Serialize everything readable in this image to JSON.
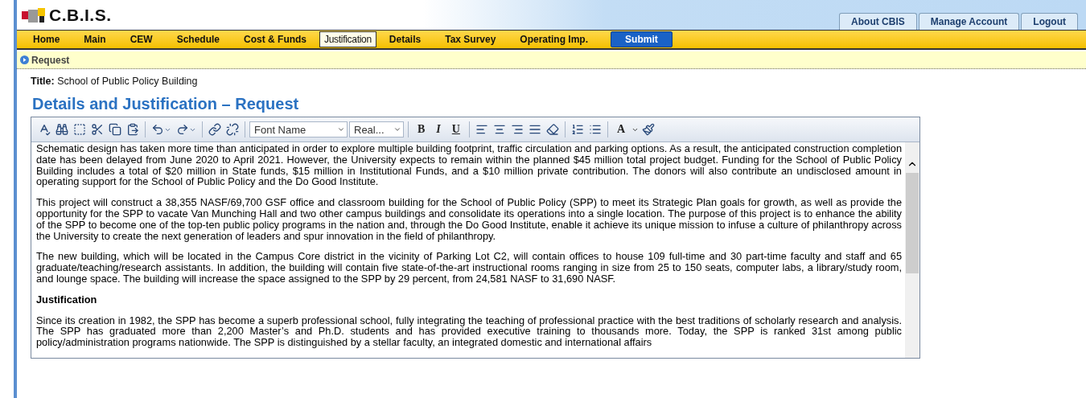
{
  "app": {
    "title": "C.B.I.S."
  },
  "top_links": [
    {
      "label": "About CBIS"
    },
    {
      "label": "Manage Account"
    },
    {
      "label": "Logout"
    }
  ],
  "menu": [
    {
      "label": "Home",
      "kind": "tab",
      "selected": false
    },
    {
      "label": "Main",
      "kind": "tab",
      "selected": false
    },
    {
      "label": "CEW",
      "kind": "tab",
      "selected": false
    },
    {
      "label": "Schedule",
      "kind": "tab",
      "selected": false
    },
    {
      "label": "Cost & Funds",
      "kind": "tab",
      "selected": false
    },
    {
      "label": "Justification",
      "kind": "tab",
      "selected": true
    },
    {
      "label": "Details",
      "kind": "tab",
      "selected": false
    },
    {
      "label": "Tax Survey",
      "kind": "tab",
      "selected": false
    },
    {
      "label": "Operating Imp.",
      "kind": "tab",
      "selected": false
    },
    {
      "label": "Submit",
      "kind": "button"
    }
  ],
  "breadcrumb": "Request",
  "title_label": "Title:",
  "title_value": "School of Public Policy Building",
  "heading": "Details and Justification – Request",
  "editor": {
    "font_name": "Font Name",
    "font_size": "Real...",
    "bold": "B",
    "italic": "I",
    "underline": "U",
    "font_color": "A",
    "content": [
      {
        "kind": "paragraph",
        "text": "Schematic design has taken more time than anticipated in order to explore multiple building footprint, traffic circulation and parking options. As a result, the anticipated construction completion date has been delayed from June 2020 to April 2021. However, the University expects to remain within the planned $45 million total project budget. Funding for the School of Public Policy Building includes a total of $20 million in State funds, $15 million in Institutional Funds, and a $10 million private contribution. The donors will also contribute an undisclosed amount in operating support for the School of Public Policy and the Do Good Institute."
      },
      {
        "kind": "paragraph",
        "text": "This project will construct a 38,355 NASF/69,700 GSF office and classroom building for the School of Public Policy (SPP) to meet its Strategic Plan goals for growth, as well as provide the opportunity for the SPP to vacate Van Munching Hall and two other campus buildings and consolidate its operations into a single location. The purpose of this project is to enhance the ability of the SPP to become one of the top-ten public policy programs in the nation and, through the Do Good Institute, enable it achieve its unique mission to infuse a culture of philanthropy across the University to create the next generation of leaders and spur innovation in the field of philanthropy."
      },
      {
        "kind": "paragraph",
        "text": "The new building, which will be located in the Campus Core district in the vicinity of Parking Lot C2, will contain offices to house 109 full-time and 30 part-time faculty and staff and 65 graduate/teaching/research assistants. In addition, the building will contain five state-of-the-art instructional rooms ranging in size from 25 to 150 seats, computer labs, a library/study room, and lounge space. The building will increase the space assigned to the SPP by 29 percent, from 24,581 NASF to 31,690 NASF."
      },
      {
        "kind": "heading",
        "text": "Justification"
      },
      {
        "kind": "paragraph",
        "text": "Since its creation in 1982, the SPP has become a superb professional school, fully integrating the teaching of professional practice with the best traditions of scholarly research and analysis. The SPP has graduated more than 2,200 Master’s and Ph.D. students and has provided executive training to thousands more. Today, the SPP is ranked 31st among public policy/administration programs nationwide. The SPP is distinguished by a stellar faculty, an integrated domestic and international affairs"
      }
    ]
  }
}
